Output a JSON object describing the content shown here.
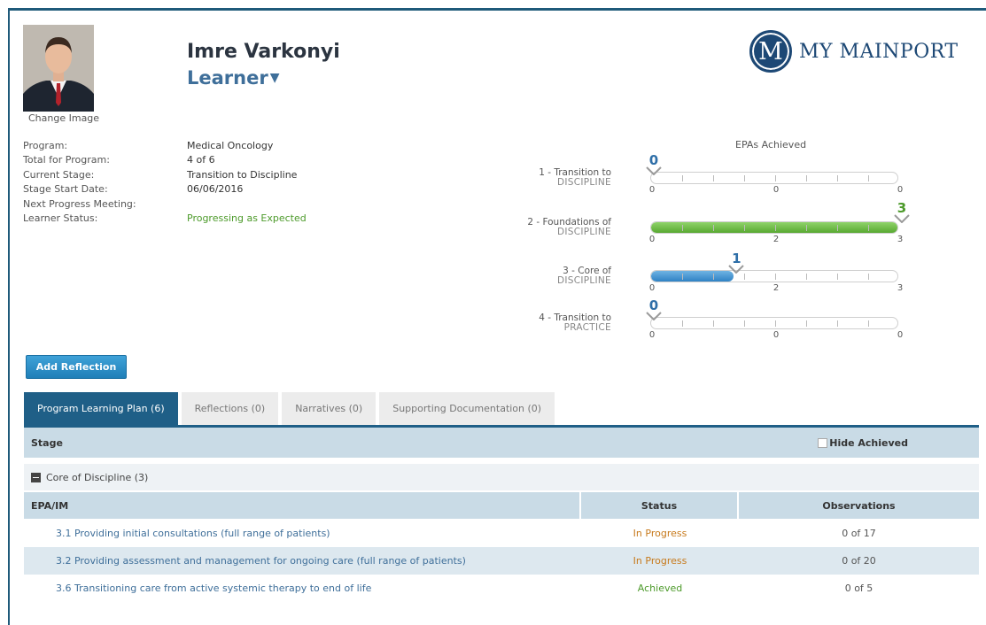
{
  "profile": {
    "name": "Imre Varkonyi",
    "role": "Learner",
    "change_image": "Change Image"
  },
  "logo": {
    "badge": "M",
    "text": "MY MAINPORT"
  },
  "info": [
    {
      "label": "Program:",
      "value": "Medical Oncology",
      "color": ""
    },
    {
      "label": "Total for Program:",
      "value": "4 of 6",
      "color": ""
    },
    {
      "label": "Current Stage:",
      "value": "Transition to Discipline",
      "color": ""
    },
    {
      "label": "Stage Start Date:",
      "value": "06/06/2016",
      "color": ""
    },
    {
      "label": "Next Progress Meeting:",
      "value": "",
      "color": ""
    },
    {
      "label": "Learner Status:",
      "value": "Progressing as Expected",
      "color": "green"
    }
  ],
  "epas": {
    "title": "EPAs Achieved",
    "stages": [
      {
        "label": "1 - Transition to",
        "sub": "DISCIPLINE",
        "value": 0,
        "max": 0,
        "scale": [
          "0",
          "0",
          "0"
        ],
        "fill": "none"
      },
      {
        "label": "2 - Foundations of",
        "sub": "DISCIPLINE",
        "value": 3,
        "max": 3,
        "scale": [
          "0",
          "2",
          "3"
        ],
        "fill": "green"
      },
      {
        "label": "3 - Core of",
        "sub": "DISCIPLINE",
        "value": 1,
        "max": 3,
        "scale": [
          "0",
          "2",
          "3"
        ],
        "fill": "blue"
      },
      {
        "label": "4 - Transition to",
        "sub": "PRACTICE",
        "value": 0,
        "max": 0,
        "scale": [
          "0",
          "0",
          "0"
        ],
        "fill": "none"
      }
    ]
  },
  "add_reflection": "Add Reflection",
  "tabs": [
    {
      "label": "Program Learning Plan (6)",
      "active": true
    },
    {
      "label": "Reflections (0)",
      "active": false
    },
    {
      "label": "Narratives (0)",
      "active": false
    },
    {
      "label": "Supporting Documentation (0)",
      "active": false
    }
  ],
  "table": {
    "stage_header": "Stage",
    "hide_achieved": "Hide Achieved",
    "group": "Core of Discipline (3)",
    "columns": [
      "EPA/IM",
      "Status",
      "Observations"
    ],
    "rows": [
      {
        "epa": "3.1 Providing initial consultations (full range of patients)",
        "status": "In Progress",
        "status_type": "progress",
        "obs": "0 of 17"
      },
      {
        "epa": "3.2 Providing assessment and management for ongoing care (full range of patients)",
        "status": "In Progress",
        "status_type": "progress",
        "obs": "0 of 20"
      },
      {
        "epa": "3.6 Transitioning care from active systemic therapy to end of life",
        "status": "Achieved",
        "status_type": "achieved",
        "obs": "0 of 5"
      }
    ]
  },
  "colors": {
    "brand": "#1d4875",
    "tab_active": "#1f5f87",
    "green": "#4c9a2a",
    "blue_marker": "#2f6fa8",
    "in_progress": "#c77a1c"
  }
}
